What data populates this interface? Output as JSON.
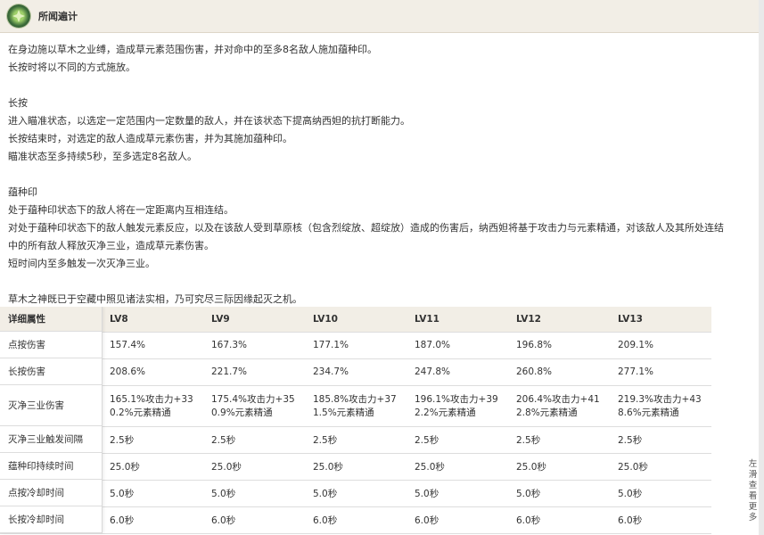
{
  "header": {
    "title": "所闻遍计",
    "icon": "dendro-skill-icon"
  },
  "description": [
    "在身边施以草木之业缚，造成草元素范围伤害，并对命中的至多8名敌人施加蕴种印。",
    "长按时将以不同的方式施放。",
    "",
    "长按",
    "进入瞄准状态，以选定一定范围内一定数量的敌人，并在该状态下提高纳西妲的抗打断能力。",
    "长按结束时，对选定的敌人造成草元素伤害，并为其施加蕴种印。",
    "瞄准状态至多持续5秒，至多选定8名敌人。",
    "",
    "蕴种印",
    "处于蕴种印状态下的敌人将在一定距离内互相连结。",
    "对处于蕴种印状态下的敌人触发元素反应，以及在该敌人受到草原核（包含烈绽放、超绽放）造成的伤害后，纳西妲将基于攻击力与元素精通，对该敌人及其所处连结",
    "中的所有敌人释放灭净三业，造成草元素伤害。",
    "短时间内至多触发一次灭净三业。",
    "",
    "草木之神既已于空藏中照见诸法实相，乃可究尽三际因缘起灭之机。"
  ],
  "table": {
    "corner_label": "详细属性",
    "levels": [
      "LV8",
      "LV9",
      "LV10",
      "LV11",
      "LV12",
      "LV13"
    ],
    "rows": [
      {
        "label": "点按伤害",
        "partial": "",
        "values": [
          "157.4%",
          "167.3%",
          "177.1%",
          "187.0%",
          "196.8%",
          "209.1%"
        ]
      },
      {
        "label": "长按伤害",
        "partial": "",
        "values": [
          "208.6%",
          "221.7%",
          "234.7%",
          "247.8%",
          "260.8%",
          "277.1%"
        ]
      },
      {
        "label": "灭净三业伤害",
        "partial_l1": "击力+30",
        "partial_l2": "精通",
        "values_l1": [
          "165.1%攻击力+33",
          "175.4%攻击力+35",
          "185.8%攻击力+37",
          "196.1%攻击力+39",
          "206.4%攻击力+41",
          "219.3%攻击力+43"
        ],
        "values_l2": [
          "0.2%元素精通",
          "0.9%元素精通",
          "1.5%元素精通",
          "2.2%元素精通",
          "2.8%元素精通",
          "8.6%元素精通"
        ]
      },
      {
        "label": "灭净三业触发间隔",
        "partial": "",
        "values": [
          "2.5秒",
          "2.5秒",
          "2.5秒",
          "2.5秒",
          "2.5秒",
          "2.5秒"
        ]
      },
      {
        "label": "蕴种印持续时间",
        "partial": "",
        "values": [
          "25.0秒",
          "25.0秒",
          "25.0秒",
          "25.0秒",
          "25.0秒",
          "25.0秒"
        ]
      },
      {
        "label": "点按冷却时间",
        "partial": "",
        "values": [
          "5.0秒",
          "5.0秒",
          "5.0秒",
          "5.0秒",
          "5.0秒",
          "5.0秒"
        ]
      },
      {
        "label": "长按冷却时间",
        "partial": "",
        "values": [
          "6.0秒",
          "6.0秒",
          "6.0秒",
          "6.0秒",
          "6.0秒",
          "6.0秒"
        ]
      }
    ]
  },
  "scroll_hint": "左滑查看更多"
}
